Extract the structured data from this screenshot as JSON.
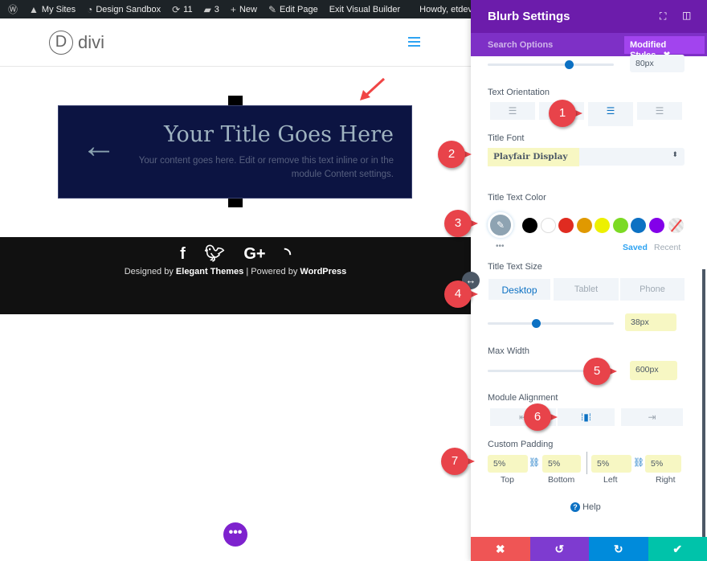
{
  "adminbar": {
    "items": [
      {
        "icon": "wordpress-icon",
        "label": ""
      },
      {
        "icon": "my-sites-icon",
        "label": "My Sites"
      },
      {
        "icon": "dashboard-icon",
        "label": "Design Sandbox"
      },
      {
        "icon": "updates-icon",
        "label": "11"
      },
      {
        "icon": "comments-icon",
        "label": "3"
      },
      {
        "icon": "plus-icon",
        "label": "New"
      },
      {
        "icon": "pencil-icon",
        "label": "Edit Page"
      },
      {
        "icon": "",
        "label": "Exit Visual Builder"
      }
    ],
    "howdy": "Howdy, etdev",
    "search_icon": "search-icon"
  },
  "site": {
    "logo_letter": "D",
    "logo_text": "divi"
  },
  "blurb": {
    "title": "Your Title Goes Here",
    "content": "Your content goes here. Edit or remove this text inline or in the module Content settings.",
    "icon": "arrow-left-icon",
    "bg_color": "#0c1442"
  },
  "footer": {
    "social": [
      "f",
      "twitter",
      "G+",
      "rss"
    ],
    "designed_by": "Designed by ",
    "elegant": "Elegant Themes",
    "sep": " | Powered by ",
    "wordpress": "WordPress"
  },
  "panel": {
    "title": "Blurb Settings",
    "search": "Search Options",
    "modified": "Modified Styles",
    "top_slider_value": "80px",
    "text_orientation": {
      "label": "Text Orientation",
      "selected": "center"
    },
    "title_font": {
      "label": "Title Font",
      "value": "Playfair Display"
    },
    "title_text_color": {
      "label": "Title Text Color",
      "swatches": [
        "#000000",
        "#ffffff",
        "#e02b20",
        "#e09900",
        "#edf000",
        "#7cda24",
        "#0c71c3",
        "#8300e9"
      ],
      "saved": "Saved",
      "recent": "Recent"
    },
    "title_text_size": {
      "label": "Title Text Size",
      "tabs": [
        "Desktop",
        "Tablet",
        "Phone"
      ],
      "value": "38px"
    },
    "max_width": {
      "label": "Max Width",
      "value": "600px"
    },
    "module_alignment": {
      "label": "Module Alignment",
      "selected": "center"
    },
    "custom_padding": {
      "label": "Custom Padding",
      "values": [
        "5%",
        "5%",
        "5%",
        "5%"
      ],
      "labels": [
        "Top",
        "Bottom",
        "Left",
        "Right"
      ]
    },
    "help": "Help"
  },
  "callouts": [
    "1",
    "2",
    "3",
    "4",
    "5",
    "6",
    "7"
  ],
  "colors": {
    "purple": "#6c1cab",
    "cancel": "#ef5555",
    "undo": "#7e3bd0",
    "redo": "#008bdb",
    "save": "#00c3aa"
  }
}
